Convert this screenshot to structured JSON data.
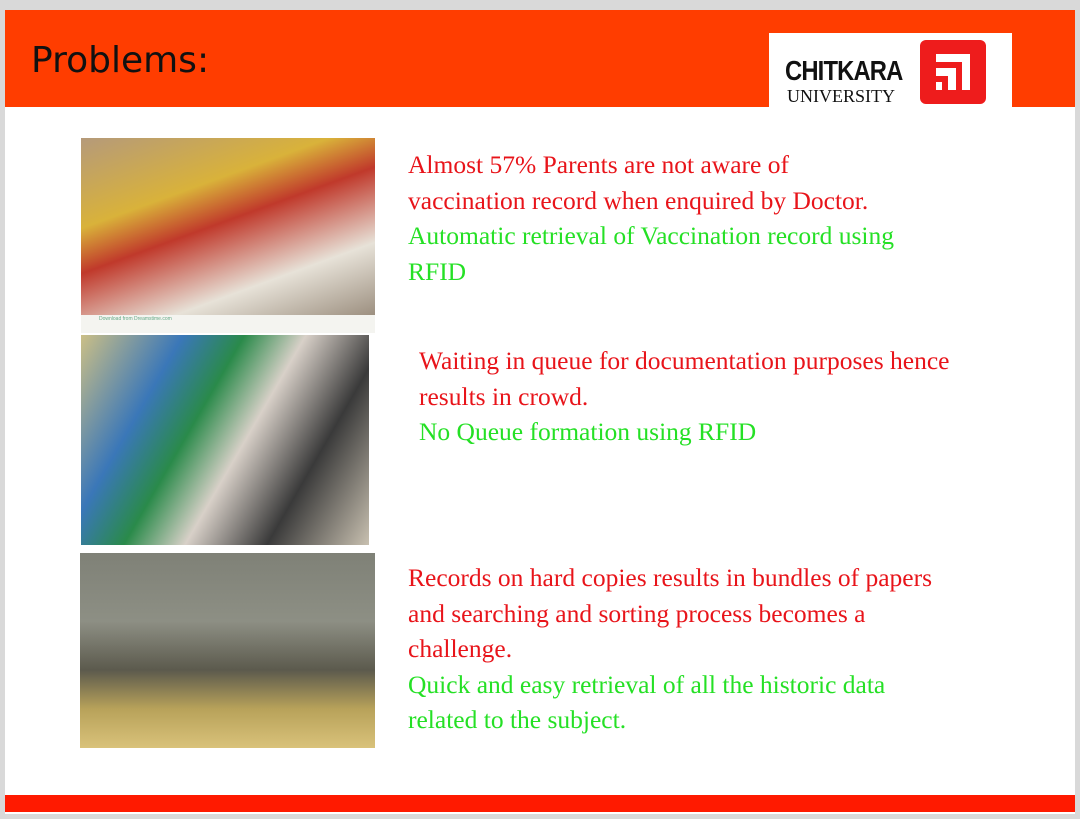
{
  "header": {
    "title": "Problems:"
  },
  "logo": {
    "line1": "CHITKARA",
    "line2": "UNIVERSITY"
  },
  "colors": {
    "header": "#ff3d00",
    "problem_text": "#e8141a",
    "solution_text": "#25e025",
    "footer": "#ff1a00"
  },
  "items": [
    {
      "image": "parents-with-children-at-doctor-photo",
      "watermark": "Download from Dreamstime.com",
      "problem": [
        "Almost 57% Parents are not aware of",
        "vaccination record when enquired by Doctor."
      ],
      "solution": [
        "Automatic retrieval of Vaccination record using",
        "RFID"
      ]
    },
    {
      "image": "people-waiting-in-queue-photo",
      "problem": [
        "Waiting in queue for documentation purposes hence",
        "results in crowd."
      ],
      "solution": [
        "No Queue formation using RFID"
      ]
    },
    {
      "image": "paper-records-room-photo",
      "problem": [
        "Records on hard copies results in bundles of papers",
        "and searching and sorting process becomes a",
        "challenge."
      ],
      "solution": [
        "Quick and easy retrieval of all the historic data",
        "related to the subject."
      ]
    }
  ]
}
